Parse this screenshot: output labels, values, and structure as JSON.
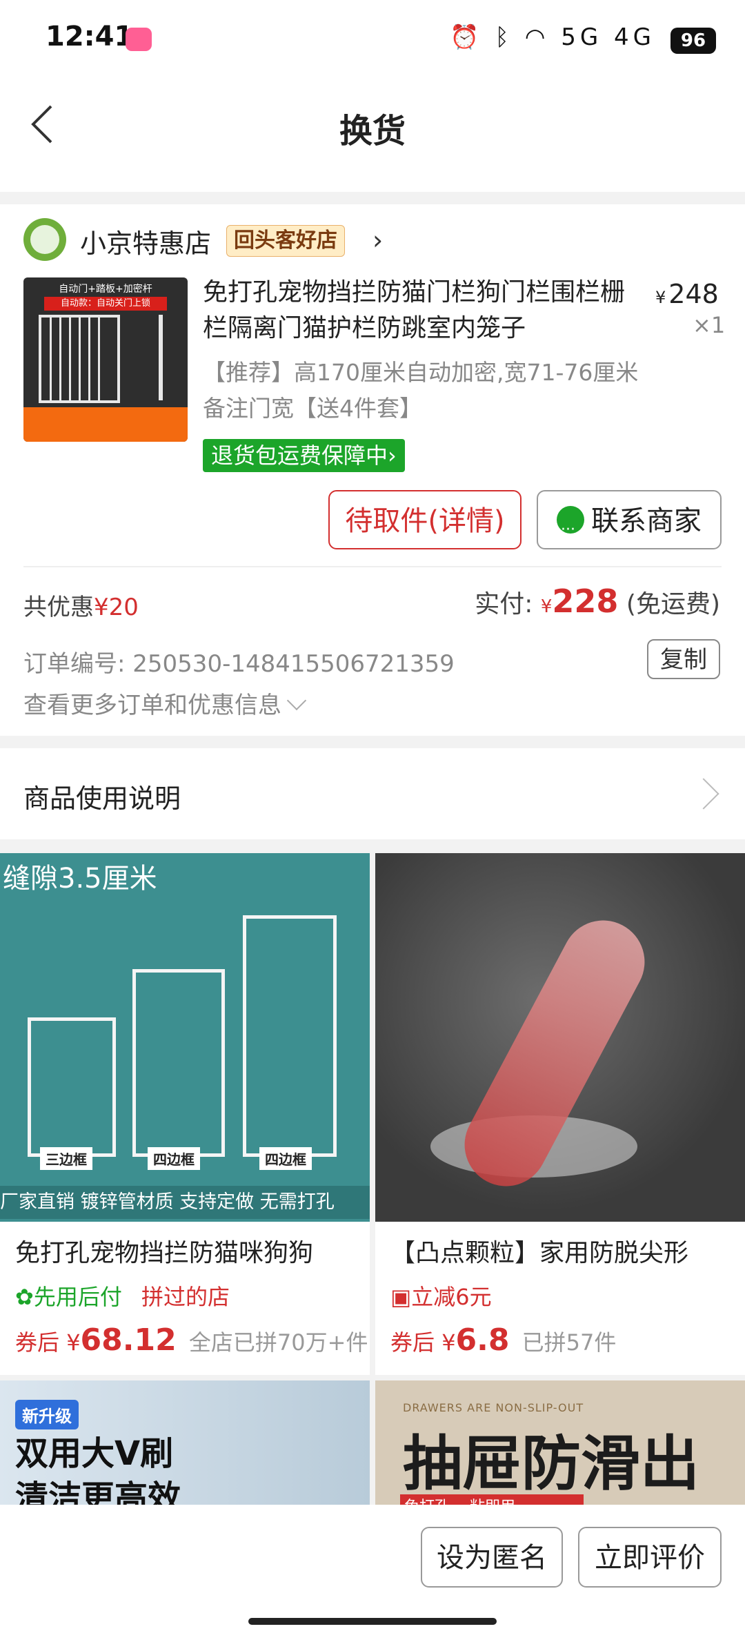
{
  "status_bar": {
    "time": "12:41",
    "network": "5G 4G",
    "battery": "96"
  },
  "header": {
    "title": "换货"
  },
  "store": {
    "name": "小京特惠店",
    "badge": "回头客好店"
  },
  "product": {
    "title": "免打孔宠物挡拦防猫门栏狗门栏围栏栅栏隔离门猫护栏防跳室内笼子",
    "price_currency": "¥",
    "price": "248",
    "qty": "×1",
    "spec": "【推荐】高170厘米自动加密,宽71-76厘米备注门宽【送4件套】",
    "return_tag": "退货包运费保障中",
    "image_caption": "自动门+踏板+加密杆",
    "image_sub": "自动款：自动关门上锁"
  },
  "actions": {
    "pickup": "待取件(详情)",
    "contact": "联系商家"
  },
  "summary": {
    "discount_label": "共优惠",
    "discount_value": "¥20",
    "pay_label": "实付:",
    "pay_currency": "¥",
    "pay_amount": "228",
    "pay_note": "(免运费)"
  },
  "order": {
    "number_label": "订单编号:",
    "number": "250530-148415506721359",
    "copy": "复制",
    "more": "查看更多订单和优惠信息"
  },
  "usage": {
    "label": "商品使用说明"
  },
  "recommendations": [
    {
      "title": "免打孔宠物挡拦防猫咪狗狗",
      "tag_green": "先用后付",
      "tag_red": "拼过的店",
      "price_prefix": "券后",
      "currency": "¥",
      "price": "68.12",
      "sold": "全店已拼70万+件",
      "img_top": "缝隙3.5厘米",
      "img_labels": [
        "三边框",
        "四边框",
        "四边框"
      ],
      "img_footer": "厂家直销  镀锌管材质  支持定做  无需打孔"
    },
    {
      "title": "【凸点颗粒】家用防脱尖形",
      "tag_red": "立减6元",
      "price_prefix": "券后",
      "currency": "¥",
      "price": "6.8",
      "sold": "已拼57件"
    },
    {
      "badge": "新升级",
      "line1": "双用大V刷",
      "line2": "清洁更高效"
    },
    {
      "small": "DRAWERS ARE NON-SLIP-OUT",
      "big": "抽屉防滑出",
      "strip": "免打孔 一粘即用"
    }
  ],
  "bottom": {
    "anonymous": "设为匿名",
    "review": "立即评价"
  },
  "colors": {
    "accent_red": "#d32f2f",
    "green": "#1ca52a"
  }
}
